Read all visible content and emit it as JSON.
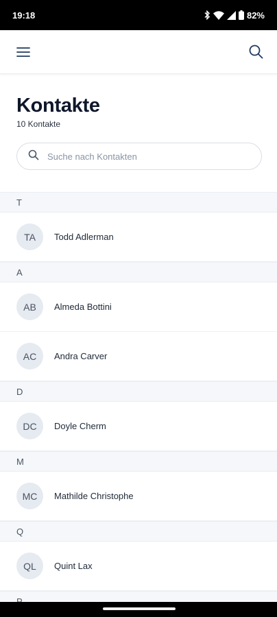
{
  "status_bar": {
    "time": "19:18",
    "battery": "82%",
    "icons": [
      "bluetooth-icon",
      "wifi-icon",
      "signal-icon",
      "battery-icon"
    ]
  },
  "topbar": {
    "menu_icon": "hamburger-menu-icon",
    "language_flag": "germany-flag-icon",
    "search_icon": "search-icon"
  },
  "header": {
    "title": "Kontakte",
    "count": "10 Kontakte"
  },
  "search": {
    "placeholder": "Suche nach Kontakten",
    "value": ""
  },
  "sections": [
    {
      "letter": "T",
      "contacts": [
        {
          "initials": "TA",
          "name": "Todd Adlerman"
        }
      ]
    },
    {
      "letter": "A",
      "contacts": [
        {
          "initials": "AB",
          "name": "Almeda Bottini"
        },
        {
          "initials": "AC",
          "name": "Andra Carver"
        }
      ]
    },
    {
      "letter": "D",
      "contacts": [
        {
          "initials": "DC",
          "name": "Doyle Cherm"
        }
      ]
    },
    {
      "letter": "M",
      "contacts": [
        {
          "initials": "MC",
          "name": "Mathilde Christophe"
        }
      ]
    },
    {
      "letter": "Q",
      "contacts": [
        {
          "initials": "QL",
          "name": "Quint Lax"
        }
      ]
    },
    {
      "letter": "P",
      "contacts": []
    }
  ],
  "colors": {
    "title": "#0f172a",
    "avatar_bg": "#e6eaf1",
    "section_bg": "#f5f7fa",
    "flag_black": "#000000",
    "flag_red": "#dd0000",
    "flag_gold": "#ffce00"
  }
}
